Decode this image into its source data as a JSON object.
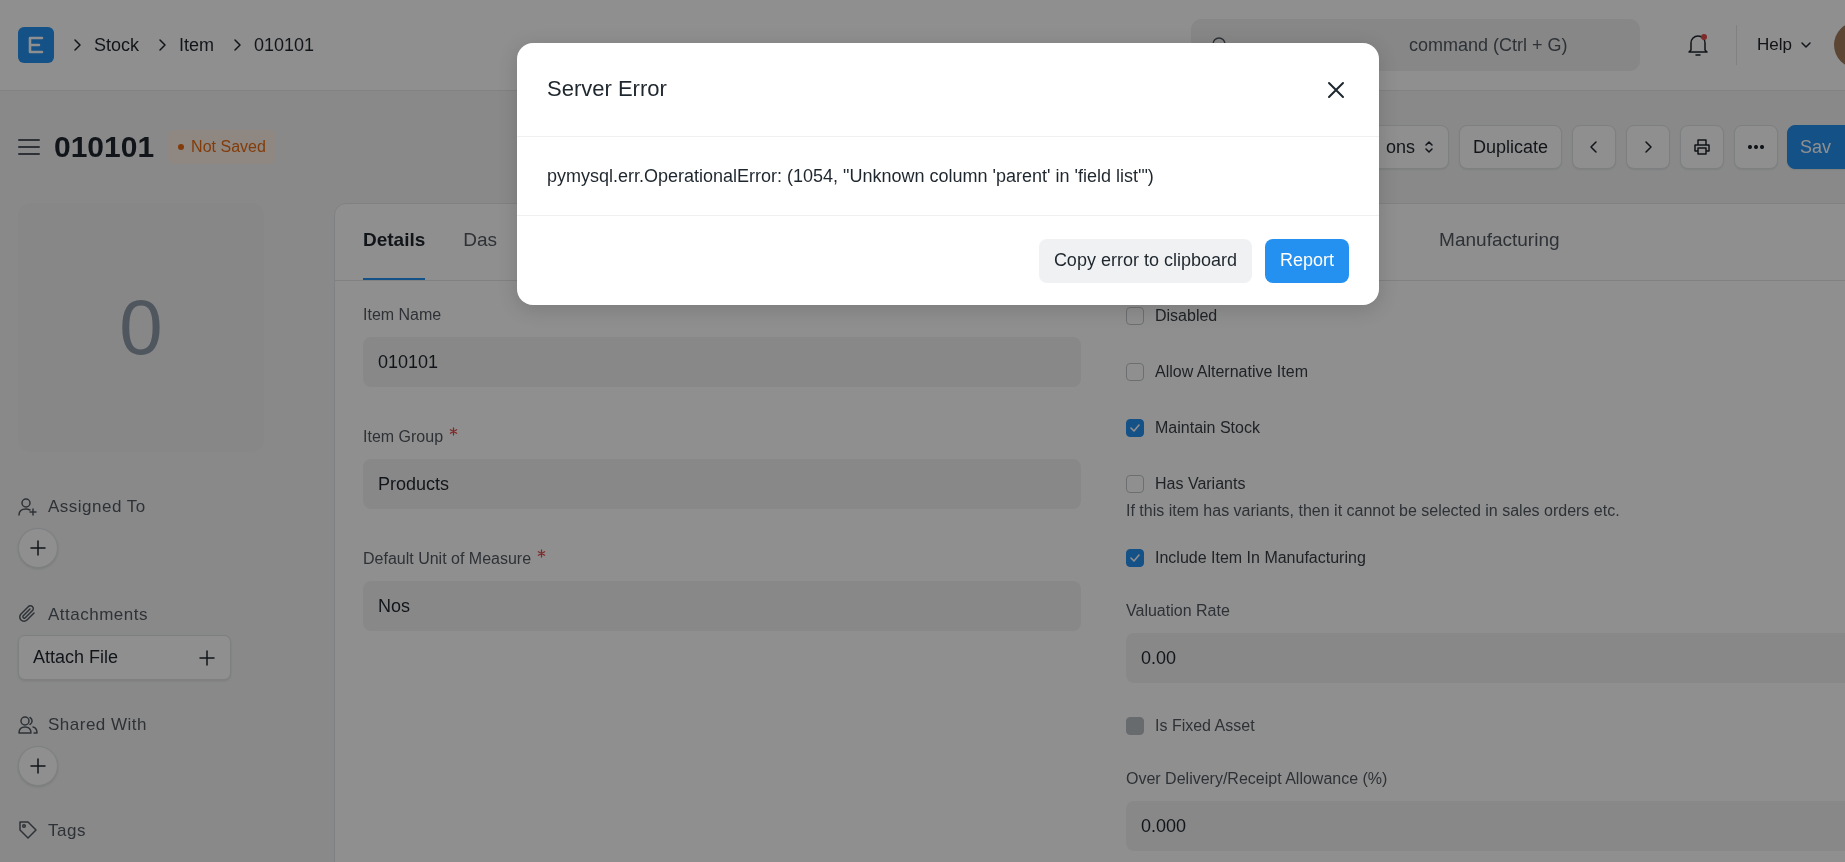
{
  "navbar": {
    "breadcrumbs": [
      "Stock",
      "Item",
      "010101"
    ],
    "search": {
      "placeholder": "command (Ctrl + G)"
    },
    "notifications": {
      "unread": true
    },
    "help": "Help"
  },
  "page_header": {
    "title": "010101",
    "indicator": {
      "label": "Not Saved",
      "color": "#823c0b"
    },
    "actions": [
      {
        "kind": "dropdown",
        "label": "ons"
      },
      {
        "kind": "text",
        "label": "Duplicate"
      },
      {
        "kind": "previous"
      },
      {
        "kind": "next"
      },
      {
        "kind": "print"
      },
      {
        "kind": "more"
      },
      {
        "kind": "primary",
        "label": "Sav"
      }
    ]
  },
  "sidebar": {
    "image_placeholder": "0",
    "sections": [
      {
        "kind": "assign",
        "label": "Assigned To"
      },
      {
        "kind": "attachments",
        "label": "Attachments",
        "button": "Attach File"
      },
      {
        "kind": "share",
        "label": "Shared With"
      },
      {
        "kind": "tags",
        "label": "Tags"
      }
    ]
  },
  "tabs": [
    {
      "label": "Details",
      "selected": true
    },
    {
      "label": "Das",
      "selected": false
    },
    {
      "label": "Manufacturing",
      "selected": false
    }
  ],
  "left_fields": [
    {
      "label": "Item Name",
      "required": false,
      "value": "010101"
    },
    {
      "label": "Item Group",
      "required": true,
      "value": "Products"
    },
    {
      "label": "Default Unit of Measure",
      "required": true,
      "value": "Nos"
    }
  ],
  "right_fields": [
    {
      "kind": "checkbox",
      "label": "Disabled",
      "checked": false,
      "disabled": false
    },
    {
      "kind": "checkbox",
      "label": "Allow Alternative Item",
      "checked": false,
      "disabled": false
    },
    {
      "kind": "checkbox",
      "label": "Maintain Stock",
      "checked": true,
      "disabled": false
    },
    {
      "kind": "checkbox",
      "label": "Has Variants",
      "checked": false,
      "disabled": false,
      "description": "If this item has variants, then it cannot be selected in sales orders etc."
    },
    {
      "kind": "checkbox",
      "label": "Include Item In Manufacturing",
      "checked": true,
      "disabled": false
    },
    {
      "kind": "input",
      "label": "Valuation Rate",
      "value": "0.00"
    },
    {
      "kind": "checkbox",
      "label": "Is Fixed Asset",
      "checked": false,
      "disabled": true
    },
    {
      "kind": "input",
      "label": "Over Delivery/Receipt Allowance (%)",
      "value": "0.000"
    }
  ],
  "modal": {
    "title": "Server Error",
    "message": "pymysql.err.OperationalError: (1054, \"Unknown column 'parent' in 'field list'\")",
    "buttons": [
      {
        "kind": "secondary",
        "label": "Copy error to clipboard"
      },
      {
        "kind": "primary",
        "label": "Report"
      }
    ]
  }
}
